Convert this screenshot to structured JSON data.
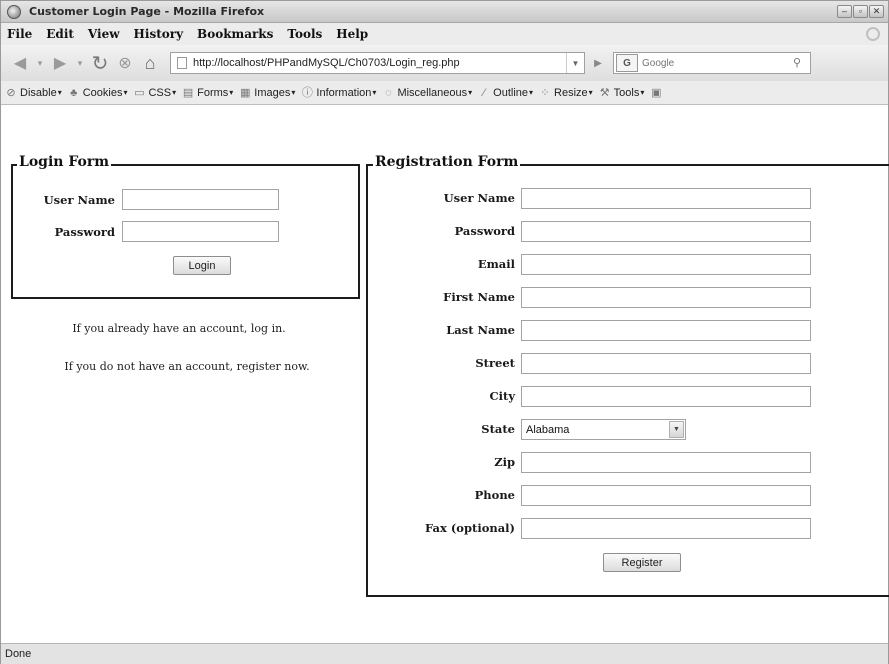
{
  "window": {
    "title": "Customer Login Page - Mozilla Firefox",
    "controls": [
      "–",
      "▫",
      "✕"
    ]
  },
  "menu": [
    "File",
    "Edit",
    "View",
    "History",
    "Bookmarks",
    "Tools",
    "Help"
  ],
  "navigation": {
    "url": "http://localhost/PHPandMySQL/Ch0703/Login_reg.php",
    "search_engine_glyph": "G",
    "search_placeholder": "Google",
    "icons": [
      "back-icon",
      "forward-icon",
      "reload-icon",
      "stop-icon",
      "home-icon",
      "page-icon",
      "go-icon",
      "search-icon"
    ]
  },
  "devtoolbar": {
    "items": [
      {
        "label": "Disable",
        "icon": "disable-icon"
      },
      {
        "label": "Cookies",
        "icon": "cookies-icon"
      },
      {
        "label": "CSS",
        "icon": "css-icon"
      },
      {
        "label": "Forms",
        "icon": "forms-icon"
      },
      {
        "label": "Images",
        "icon": "images-icon"
      },
      {
        "label": "Information",
        "icon": "information-icon"
      },
      {
        "label": "Miscellaneous",
        "icon": "miscellaneous-icon"
      },
      {
        "label": "Outline",
        "icon": "outline-icon"
      },
      {
        "label": "Resize",
        "icon": "resize-icon"
      },
      {
        "label": "Tools",
        "icon": "tools-icon"
      }
    ]
  },
  "login_form": {
    "legend": "Login Form",
    "user_name_label": "User Name",
    "user_name_value": "",
    "password_label": "Password",
    "password_value": "",
    "login_button": "Login"
  },
  "messages": {
    "line1": "If you already have an account, log in.",
    "line2": "If you do not have an account, register now."
  },
  "registration_form": {
    "legend": "Registration Form",
    "fields": [
      {
        "label": "User Name",
        "value": ""
      },
      {
        "label": "Password",
        "value": ""
      },
      {
        "label": "Email",
        "value": ""
      },
      {
        "label": "First Name",
        "value": ""
      },
      {
        "label": "Last Name",
        "value": ""
      },
      {
        "label": "Street",
        "value": ""
      },
      {
        "label": "City",
        "value": ""
      },
      {
        "label": "State",
        "value": "Alabama"
      },
      {
        "label": "Zip",
        "value": ""
      },
      {
        "label": "Phone",
        "value": ""
      },
      {
        "label": "Fax (optional)",
        "value": ""
      }
    ],
    "register_button": "Register"
  },
  "status": "Done"
}
